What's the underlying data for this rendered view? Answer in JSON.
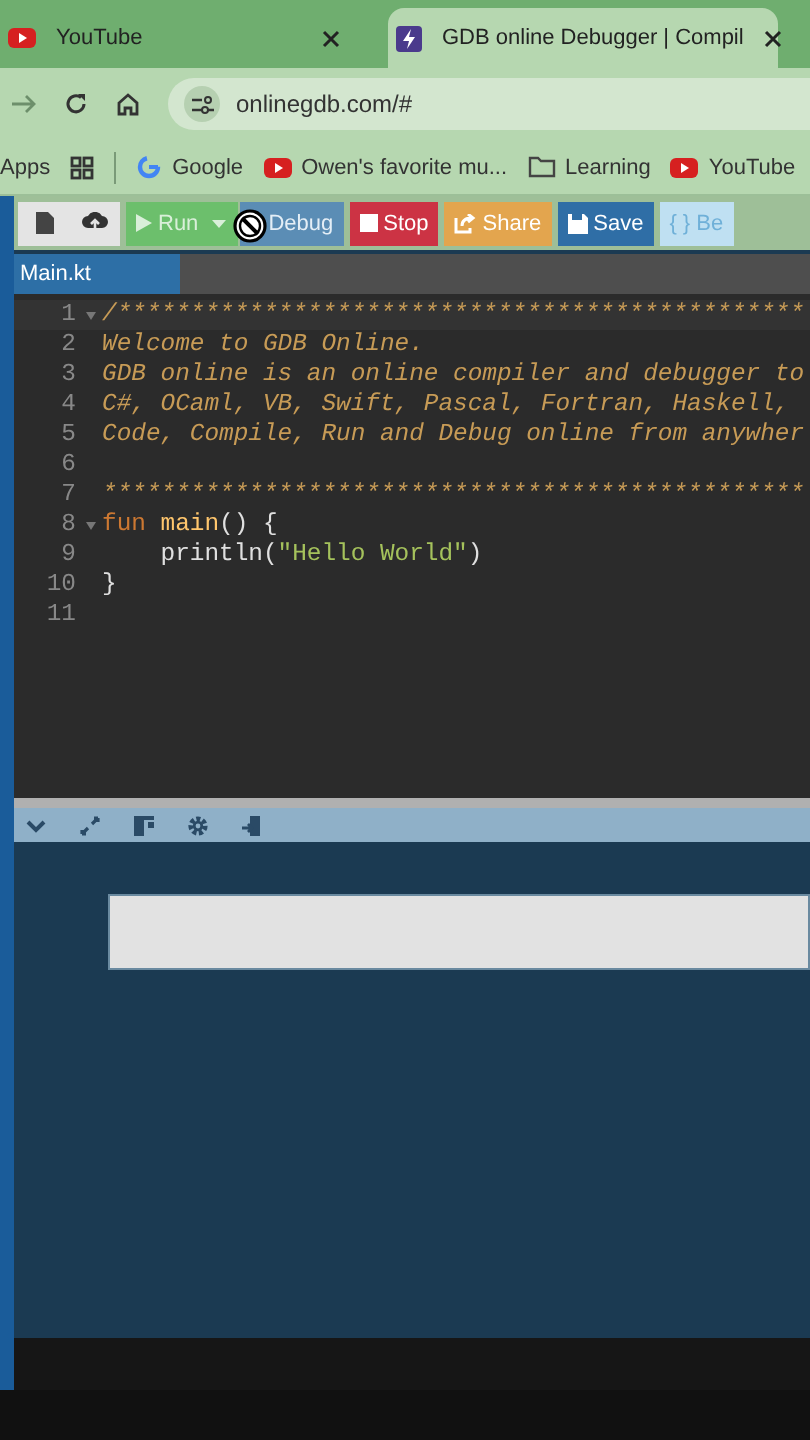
{
  "browser": {
    "tabs": [
      {
        "title": "YouTube",
        "kind": "youtube",
        "selected": false
      },
      {
        "title": "GDB online Debugger | Compil",
        "kind": "gdb",
        "selected": true
      }
    ],
    "address": "onlinegdb.com/#",
    "bookmarks": [
      {
        "label": "Apps",
        "kind": "text"
      },
      {
        "kind": "apps"
      },
      {
        "label": "Google",
        "kind": "google"
      },
      {
        "label": "Owen's favorite mu...",
        "kind": "youtube"
      },
      {
        "label": "Learning",
        "kind": "folder"
      },
      {
        "label": "YouTube",
        "kind": "youtube"
      }
    ]
  },
  "ide": {
    "toolbar": [
      {
        "kind": "new"
      },
      {
        "kind": "upload"
      },
      {
        "label": "Run",
        "kind": "run"
      },
      {
        "label": "Debug",
        "kind": "debug"
      },
      {
        "label": "Stop",
        "kind": "stop"
      },
      {
        "label": "Share",
        "kind": "share"
      },
      {
        "label": "Save",
        "kind": "save"
      },
      {
        "label": "{ } Be",
        "kind": "beautify"
      }
    ],
    "file_tabs": [
      {
        "label": "Main.kt",
        "selected": true
      }
    ],
    "lines": [
      {
        "number": "1",
        "foldable": true,
        "active": true,
        "tokens": [
          {
            "text": "/***********************************************",
            "kind": "comment"
          }
        ]
      },
      {
        "number": "2",
        "foldable": false,
        "active": false,
        "tokens": [
          {
            "text": "Welcome to GDB Online.",
            "kind": "comment"
          }
        ]
      },
      {
        "number": "3",
        "foldable": false,
        "active": false,
        "tokens": [
          {
            "text": "GDB online is an online compiler and debugger to",
            "kind": "comment"
          }
        ]
      },
      {
        "number": "4",
        "foldable": false,
        "active": false,
        "tokens": [
          {
            "text": "C#, OCaml, VB, Swift, Pascal, Fortran, Haskell,",
            "kind": "comment"
          }
        ]
      },
      {
        "number": "5",
        "foldable": false,
        "active": false,
        "tokens": [
          {
            "text": "Code, Compile, Run and Debug online from anywher",
            "kind": "comment"
          }
        ]
      },
      {
        "number": "6",
        "foldable": false,
        "active": false
      },
      {
        "number": "7",
        "foldable": false,
        "active": false,
        "tokens": [
          {
            "text": "************************************************",
            "kind": "comment"
          }
        ]
      },
      {
        "number": "8",
        "foldable": true,
        "active": false,
        "tokens": [
          {
            "text": "fun",
            "kind": "keyword"
          },
          {
            "text": "main",
            "kind": "function"
          },
          {
            "text": "() {",
            "kind": "plain"
          }
        ]
      },
      {
        "number": "9",
        "foldable": false,
        "active": false,
        "tokens": [
          {
            "text": "    println(",
            "kind": "plain"
          },
          {
            "text": "\"Hello World\"",
            "kind": "string"
          },
          {
            "text": ")",
            "kind": "plain"
          }
        ]
      },
      {
        "number": "10",
        "foldable": false,
        "active": false,
        "tokens": [
          {
            "text": "}",
            "kind": "plain"
          }
        ]
      },
      {
        "number": "11",
        "foldable": false,
        "active": false
      }
    ],
    "output_tools": [
      {
        "kind": "collapse"
      },
      {
        "kind": "expand"
      },
      {
        "kind": "layout"
      },
      {
        "kind": "settings"
      },
      {
        "kind": "clear"
      }
    ]
  }
}
